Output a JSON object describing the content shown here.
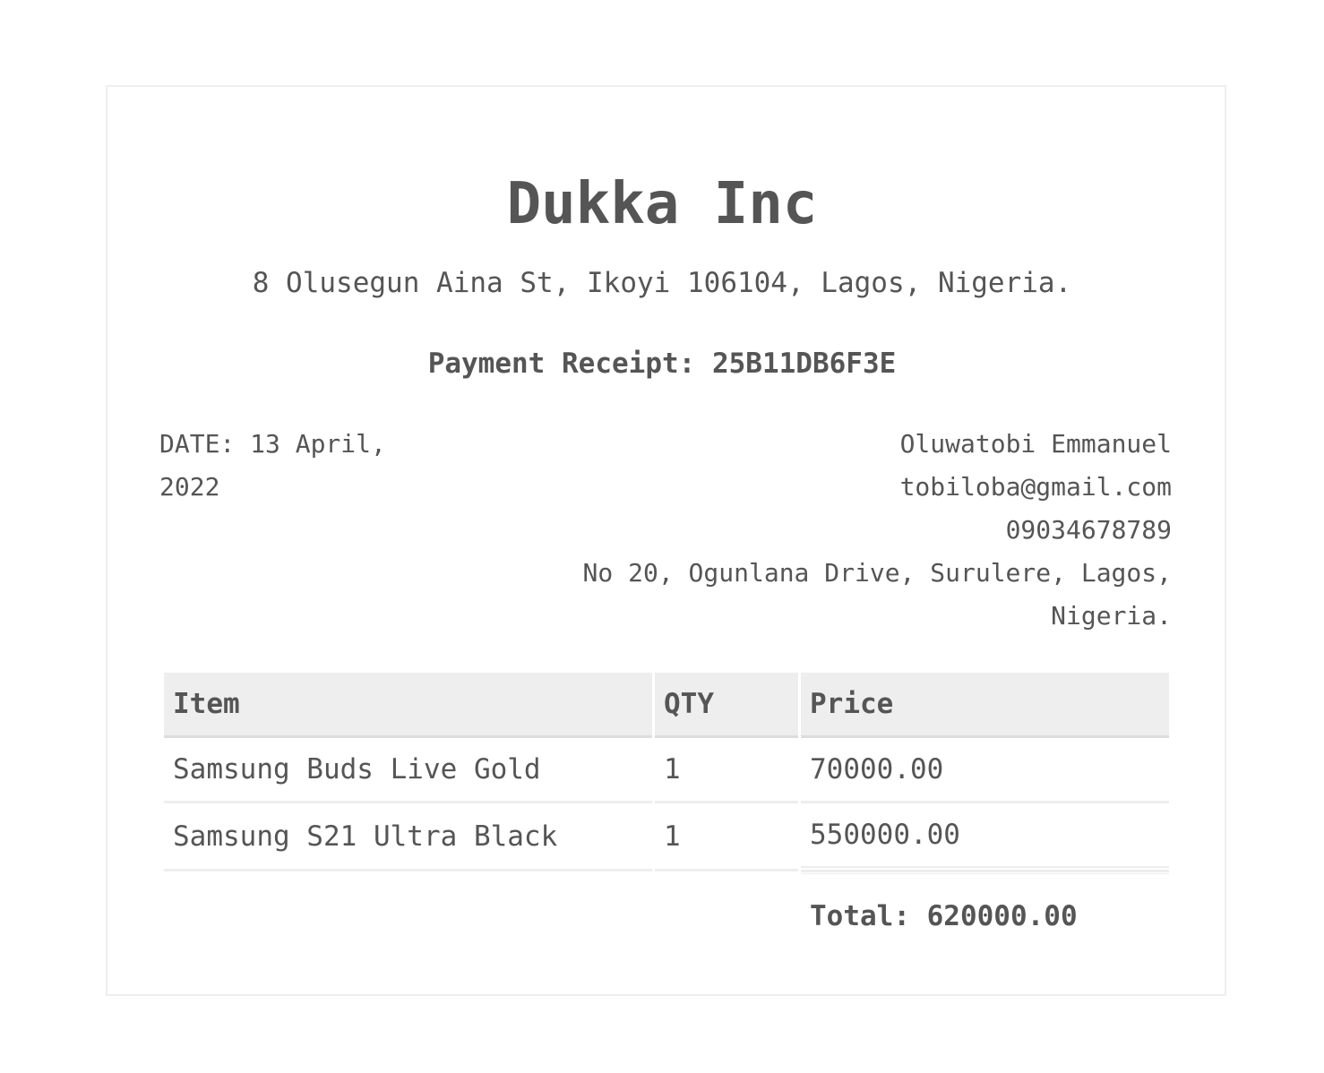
{
  "company": {
    "name": "Dukka Inc",
    "address": "8 Olusegun Aina St, Ikoyi 106104, Lagos, Nigeria."
  },
  "receipt": {
    "label": "Payment Receipt:",
    "id": "25B11DB6F3E"
  },
  "date": {
    "text": "DATE: 13 April, 2022"
  },
  "customer": {
    "name": "Oluwatobi Emmanuel",
    "email": "tobiloba@gmail.com",
    "phone": "09034678789",
    "address": "No 20, Ogunlana Drive, Surulere, Lagos, Nigeria."
  },
  "table": {
    "headers": {
      "item": "Item",
      "qty": "QTY",
      "price": "Price"
    },
    "rows": [
      {
        "item": "Samsung Buds Live Gold",
        "qty": "1",
        "price": "70000.00"
      },
      {
        "item": "Samsung S21 Ultra Black",
        "qty": "1",
        "price": "550000.00"
      }
    ],
    "total": "Total: 620000.00"
  },
  "colors": {
    "text": "#555555",
    "border": "#eeeeee",
    "header_bg": "#eeeeee"
  }
}
